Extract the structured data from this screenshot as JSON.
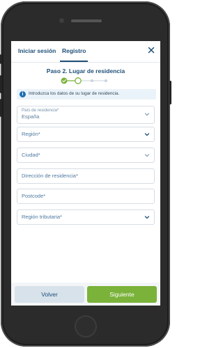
{
  "tabs": {
    "login_label": "Iniciar sesión",
    "register_label": "Registro"
  },
  "step": {
    "title": "Paso 2. Lugar de residencia",
    "total_steps": 4,
    "current_step": 2
  },
  "info": {
    "icon": "info-icon",
    "text": "Introduzca los datos de su lugar de residencia."
  },
  "form": {
    "country": {
      "label": "País de residencia*",
      "value": "España"
    },
    "region": {
      "label": "Región*"
    },
    "city": {
      "label": "Ciudad*"
    },
    "address": {
      "label": "Dirección de residencia*"
    },
    "postcode": {
      "label": "Postcode*"
    },
    "tax_region": {
      "label": "Región tributaria*"
    }
  },
  "buttons": {
    "back_label": "Volver",
    "next_label": "Siguiente"
  },
  "colors": {
    "primary": "#1e4f78",
    "accent_green": "#7ab23a",
    "info_bg": "#eaf3f9",
    "back_button": "#d7e2eb"
  }
}
